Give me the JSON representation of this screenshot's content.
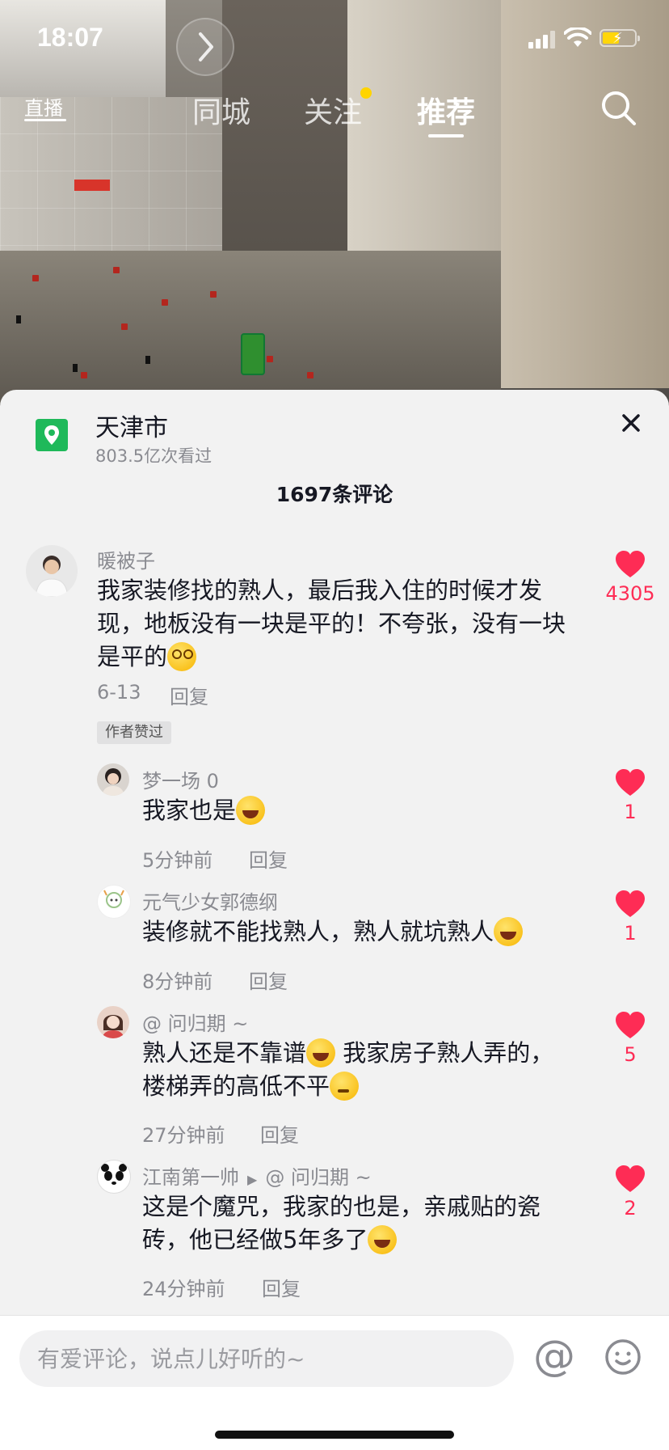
{
  "status_bar": {
    "time": "18:07"
  },
  "top_nav": {
    "live_label": "直播",
    "tabs": [
      {
        "label": "同城"
      },
      {
        "label": "关注"
      },
      {
        "label": "推荐"
      }
    ],
    "active_tab": "推荐"
  },
  "location": {
    "title": "天津市",
    "subtitle": "803.5亿次看过"
  },
  "comments_count_label": "1697条评论",
  "comments": [
    {
      "name": "暖被子",
      "text_line1": "我家装修找的熟人，最后我入住的时候才发",
      "text_line2": "现，地板没有一块是平的！不夸张，没有一块",
      "text_line3": "是平的",
      "time": "6-13",
      "reply": "回复",
      "badge": "作者赞过",
      "likes": "4305"
    },
    {
      "name": "梦一场 0",
      "text": "我家也是",
      "time": "5分钟前",
      "reply": "回复",
      "likes": "1"
    },
    {
      "name": "元气少女郭德纲",
      "text": "装修就不能找熟人，熟人就坑熟人",
      "time": "8分钟前",
      "reply": "回复",
      "likes": "1"
    },
    {
      "name": "@ 问归期 ~",
      "text_line1a": "熟人还是不靠谱",
      "text_line1b": " 我家房子熟人弄的，",
      "text_line2": "楼梯弄的高低不平",
      "time": "27分钟前",
      "reply": "回复",
      "likes": "5"
    },
    {
      "name": "江南第一帅",
      "reply_to": "@ 问归期 ~",
      "text_line1": "这是个魔咒，我家的也是，亲戚贴的瓷",
      "text_line2": "砖，他已经做5年多了",
      "time": "24分钟前",
      "reply": "回复",
      "likes": "2"
    }
  ],
  "input": {
    "placeholder": "有爱评论，说点儿好听的~"
  },
  "colors": {
    "like": "#fe2c55",
    "location_icon": "#1fb95a",
    "follow_dot": "#ffd400"
  },
  "icons": [
    "play-arrow-icon",
    "location-pin-icon",
    "close-icon",
    "heart-icon",
    "search-icon",
    "at-icon",
    "emoji-icon",
    "signal-icon",
    "wifi-icon",
    "battery-icon"
  ]
}
